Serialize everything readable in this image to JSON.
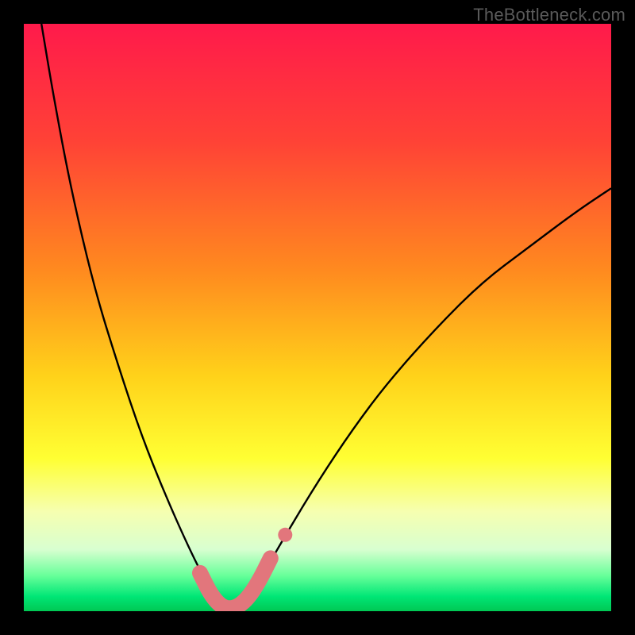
{
  "watermark": "TheBottleneck.com",
  "chart_data": {
    "type": "line",
    "title": "",
    "xlabel": "",
    "ylabel": "",
    "xlim": [
      0,
      100
    ],
    "ylim": [
      0,
      100
    ],
    "gradient_stops": [
      {
        "offset": 0.0,
        "color": "#ff1a4b"
      },
      {
        "offset": 0.2,
        "color": "#ff4236"
      },
      {
        "offset": 0.42,
        "color": "#ff8a1f"
      },
      {
        "offset": 0.6,
        "color": "#ffd21a"
      },
      {
        "offset": 0.74,
        "color": "#ffff33"
      },
      {
        "offset": 0.83,
        "color": "#f6ffb0"
      },
      {
        "offset": 0.895,
        "color": "#d8ffd0"
      },
      {
        "offset": 0.94,
        "color": "#66ff99"
      },
      {
        "offset": 0.975,
        "color": "#00e676"
      },
      {
        "offset": 1.0,
        "color": "#00c853"
      }
    ],
    "series": [
      {
        "name": "bottleneck-curve",
        "description": "V-shaped curve; zero at x≈35, rising steeply left toward 100 at x≈3, rising more gently right toward ~72 at x=100.",
        "x": [
          3,
          5,
          8,
          12,
          16,
          20,
          24,
          28,
          31,
          33,
          35,
          37,
          40,
          44,
          50,
          56,
          62,
          70,
          78,
          86,
          94,
          100
        ],
        "values": [
          100,
          88,
          72,
          55,
          42,
          30,
          20,
          11,
          5,
          1.5,
          0,
          1.5,
          5,
          12,
          22,
          31,
          39,
          48,
          56,
          62,
          68,
          72
        ]
      }
    ],
    "highlight_band": {
      "description": "Thick pink segment tracing the curve near its minimum",
      "color": "#e2767c",
      "x": [
        30,
        32,
        34,
        36,
        38,
        40,
        42
      ],
      "values": [
        6.5,
        2.5,
        0.5,
        0.5,
        2,
        5,
        9
      ]
    },
    "highlight_dot": {
      "description": "Small pink dot on right limb slightly above the band end",
      "color": "#e2767c",
      "x": 44.5,
      "value": 13
    }
  }
}
